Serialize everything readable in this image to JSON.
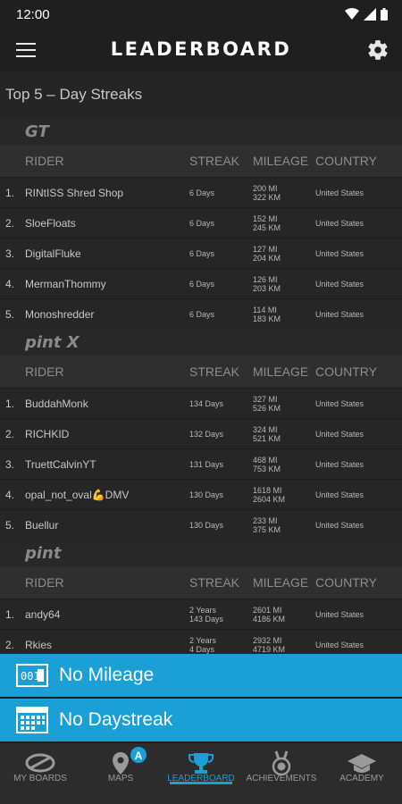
{
  "status": {
    "time": "12:00"
  },
  "app_bar": {
    "title": "LEADERBOARD"
  },
  "section_title": "Top 5 – Day Streaks",
  "columns": {
    "rider": "RIDER",
    "streak": "STREAK",
    "mileage": "MILEAGE",
    "country": "COUNTRY"
  },
  "groups": [
    {
      "logo": "GT",
      "rows": [
        {
          "rank": "1.",
          "name": "RINtISS Shred Shop",
          "streak": [
            "6 Days"
          ],
          "mileage": [
            "200 MI",
            "322 KM"
          ],
          "country": "United States"
        },
        {
          "rank": "2.",
          "name": "SloeFloats",
          "streak": [
            "6 Days"
          ],
          "mileage": [
            "152 MI",
            "245 KM"
          ],
          "country": "United States"
        },
        {
          "rank": "3.",
          "name": "DigitalFluke",
          "streak": [
            "6 Days"
          ],
          "mileage": [
            "127 MI",
            "204 KM"
          ],
          "country": "United States"
        },
        {
          "rank": "4.",
          "name": "MermanThommy",
          "streak": [
            "6 Days"
          ],
          "mileage": [
            "126 MI",
            "203 KM"
          ],
          "country": "United States"
        },
        {
          "rank": "5.",
          "name": "Monoshredder",
          "streak": [
            "6 Days"
          ],
          "mileage": [
            "114 MI",
            "183 KM"
          ],
          "country": "United States"
        }
      ]
    },
    {
      "logo": "pint X",
      "rows": [
        {
          "rank": "1.",
          "name": "BuddahMonk",
          "streak": [
            "134 Days"
          ],
          "mileage": [
            "327 MI",
            "526 KM"
          ],
          "country": "United States"
        },
        {
          "rank": "2.",
          "name": "RICHKID",
          "streak": [
            "132 Days"
          ],
          "mileage": [
            "324 MI",
            "521 KM"
          ],
          "country": "United States"
        },
        {
          "rank": "3.",
          "name": "TruettCalvinYT",
          "streak": [
            "131 Days"
          ],
          "mileage": [
            "468 MI",
            "753 KM"
          ],
          "country": "United States"
        },
        {
          "rank": "4.",
          "name": "opal_not_oval💪DMV",
          "streak": [
            "130 Days"
          ],
          "mileage": [
            "1618 MI",
            "2604 KM"
          ],
          "country": "United States"
        },
        {
          "rank": "5.",
          "name": "Buellur",
          "streak": [
            "130 Days"
          ],
          "mileage": [
            "233 MI",
            "375 KM"
          ],
          "country": "United States"
        }
      ]
    },
    {
      "logo": "pint",
      "rows": [
        {
          "rank": "1.",
          "name": "andy64",
          "streak": [
            "2 Years",
            "143 Days"
          ],
          "mileage": [
            "2601 MI",
            "4186 KM"
          ],
          "country": "United States"
        },
        {
          "rank": "2.",
          "name": "Rkies",
          "streak": [
            "2 Years",
            "4 Days"
          ],
          "mileage": [
            "2932 MI",
            "4719 KM"
          ],
          "country": "United States"
        }
      ]
    }
  ],
  "banners": {
    "mileage": "No Mileage",
    "daystreak": "No Daystreak"
  },
  "nav": [
    {
      "label": "MY BOARDS",
      "icon": "board-icon"
    },
    {
      "label": "MAPS",
      "icon": "map-pin-icon",
      "badge": "A"
    },
    {
      "label": "LEADERBOARD",
      "icon": "trophy-icon",
      "active": true
    },
    {
      "label": "ACHIEVEMENTS",
      "icon": "medal-icon"
    },
    {
      "label": "ACADEMY",
      "icon": "graduation-cap-icon"
    }
  ],
  "colors": {
    "accent": "#1a9fd6",
    "background": "#1f1f1f"
  }
}
